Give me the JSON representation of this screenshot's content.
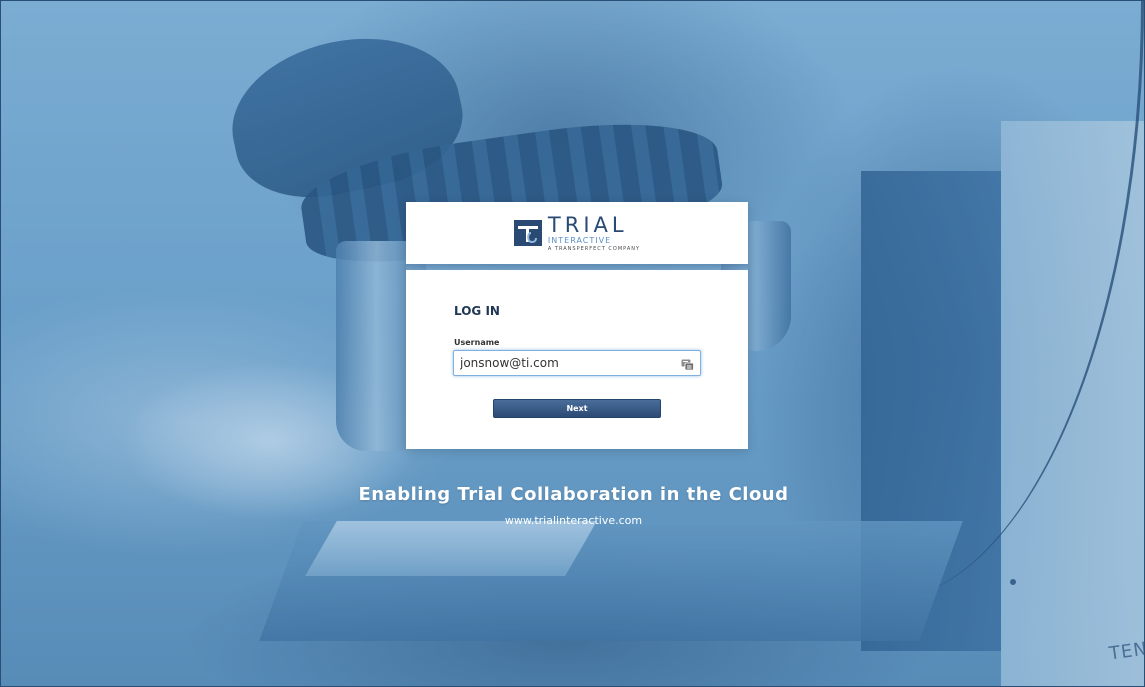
{
  "brand": {
    "name": "TRIAL",
    "sub": "INTERACTIVE",
    "tagline": "A TRANSPERFECT COMPANY"
  },
  "login": {
    "title": "LOG IN",
    "username_label": "Username",
    "username_value": "jonsnow@ti.com",
    "next_label": "Next"
  },
  "footer": {
    "headline": "Enabling Trial Collaboration in the Cloud",
    "url": "www.trialinteractive.com"
  },
  "background": {
    "corner_text": "TEN"
  },
  "colors": {
    "primary": "#2b4b76",
    "accent": "#5a8fc8",
    "input_focus": "#7fb0e0"
  },
  "icons": {
    "autofill": "password-autofill-icon",
    "logo": "trial-interactive-logo-icon"
  }
}
